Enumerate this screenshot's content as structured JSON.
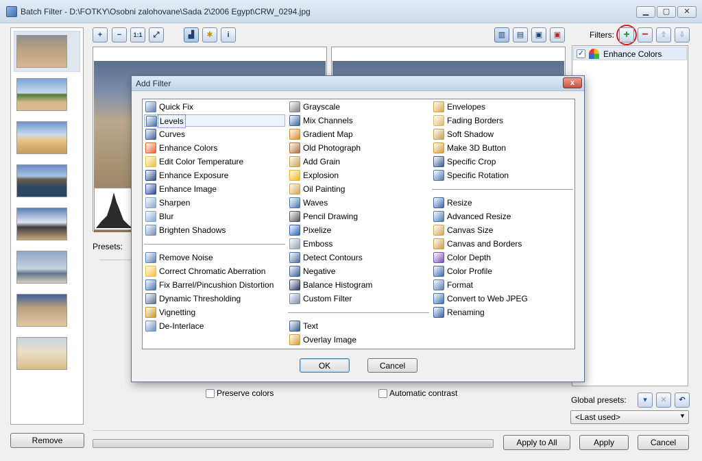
{
  "window": {
    "title": "Batch Filter - D:\\FOTKY\\Osobni zalohovane\\Sada 2\\2006 Egypt\\CRW_0294.jpg",
    "controls": [
      "minimize",
      "maximize",
      "close"
    ]
  },
  "toolbar": {
    "zoom_in": "+",
    "zoom_out": "−",
    "actual_size": "1:1",
    "fit": "⤢",
    "histogram": "▟",
    "auto": "✱",
    "info": "i"
  },
  "filters_panel": {
    "label": "Filters:",
    "items": [
      {
        "checked": true,
        "label": "Enhance Colors"
      }
    ]
  },
  "options": {
    "presets_label": "Presets:",
    "preserve_colors": "Preserve colors",
    "automatic_contrast": "Automatic contrast"
  },
  "global_presets": {
    "label": "Global presets:",
    "selected": "<Last used>"
  },
  "buttons": {
    "remove": "Remove",
    "apply_to_all": "Apply to All",
    "apply": "Apply",
    "cancel": "Cancel"
  },
  "dialog": {
    "title": "Add Filter",
    "close": "x",
    "ok": "OK",
    "cancel": "Cancel",
    "columns": [
      [
        {
          "label": "Quick Fix",
          "icon": "quick-fix-icon",
          "color": "#5b7fb3"
        },
        {
          "label": "Levels",
          "icon": "levels-icon",
          "color": "#4a6fa8",
          "selected": true
        },
        {
          "label": "Curves",
          "icon": "curves-icon",
          "color": "#3c5f98"
        },
        {
          "label": "Enhance Colors",
          "icon": "rainbow-icon",
          "color": "#e0662c"
        },
        {
          "label": "Edit Color Temperature",
          "icon": "bulb-icon",
          "color": "#e8c23a"
        },
        {
          "label": "Enhance Exposure",
          "icon": "exposure-icon",
          "color": "#2c4d86"
        },
        {
          "label": "Enhance Image",
          "icon": "enhance-image-icon",
          "color": "#27499a"
        },
        {
          "label": "Sharpen",
          "icon": "sharpen-icon",
          "color": "#8aa4c8"
        },
        {
          "label": "Blur",
          "icon": "blur-icon",
          "color": "#7fa8d6"
        },
        {
          "label": "Brighten Shadows",
          "icon": "shadows-icon",
          "color": "#6f8db8"
        },
        {
          "label": "Remove Noise",
          "icon": "noise-icon",
          "color": "#5e81b8"
        },
        {
          "label": "Correct Chromatic Aberration",
          "icon": "star-icon",
          "color": "#f0c23a"
        },
        {
          "label": "Fix Barrel/Pincushion Distortion",
          "icon": "distortion-icon",
          "color": "#4a76b0"
        },
        {
          "label": "Dynamic Thresholding",
          "icon": "threshold-icon",
          "color": "#5b6f8e"
        },
        {
          "label": "Vignetting",
          "icon": "vignette-icon",
          "color": "#c59a2e"
        },
        {
          "label": "De-Interlace",
          "icon": "deinterlace-icon",
          "color": "#6c8cbc"
        }
      ],
      [
        {
          "label": "Grayscale",
          "icon": "grayscale-icon",
          "color": "#808080"
        },
        {
          "label": "Mix Channels",
          "icon": "mix-channels-icon",
          "color": "#3d62a0"
        },
        {
          "label": "Gradient Map",
          "icon": "gradient-icon",
          "color": "#d98a2a"
        },
        {
          "label": "Old Photograph",
          "icon": "old-photo-icon",
          "color": "#a8743a"
        },
        {
          "label": "Add Grain",
          "icon": "grain-icon",
          "color": "#c9a24e"
        },
        {
          "label": "Explosion",
          "icon": "explosion-icon",
          "color": "#f2b21c"
        },
        {
          "label": "Oil Painting",
          "icon": "palette-icon",
          "color": "#d2a452"
        },
        {
          "label": "Waves",
          "icon": "waves-icon",
          "color": "#4a73b4"
        },
        {
          "label": "Pencil Drawing",
          "icon": "pencil-icon",
          "color": "#555555"
        },
        {
          "label": "Pixelize",
          "icon": "pixelize-icon",
          "color": "#2f63b6"
        },
        {
          "label": "Emboss",
          "icon": "emboss-icon",
          "color": "#8f9fb5"
        },
        {
          "label": "Detect Contours",
          "icon": "contours-icon",
          "color": "#4c6d9e"
        },
        {
          "label": "Negative",
          "icon": "negative-icon",
          "color": "#3b5e9a"
        },
        {
          "label": "Balance Histogram",
          "icon": "histogram-icon",
          "color": "#2e3f5f"
        },
        {
          "label": "Custom Filter",
          "icon": "grid-icon",
          "color": "#7a8ea8"
        },
        {
          "label": "Text",
          "icon": "text-icon",
          "color": "#3a5a8c"
        },
        {
          "label": "Overlay Image",
          "icon": "overlay-icon",
          "color": "#d59b2c"
        }
      ],
      [
        {
          "label": "Envelopes",
          "icon": "envelope-icon",
          "color": "#d8a542"
        },
        {
          "label": "Fading Borders",
          "icon": "fading-borders-icon",
          "color": "#e2b86a"
        },
        {
          "label": "Soft Shadow",
          "icon": "soft-shadow-icon",
          "color": "#c4a050"
        },
        {
          "label": "Make 3D Button",
          "icon": "button-3d-icon",
          "color": "#d69b36"
        },
        {
          "label": "Specific Crop",
          "icon": "crop-icon",
          "color": "#3a5c92"
        },
        {
          "label": "Specific Rotation",
          "icon": "rotate-icon",
          "color": "#4f79b4"
        },
        {
          "label": "Resize",
          "icon": "resize-icon",
          "color": "#3b67a8"
        },
        {
          "label": "Advanced Resize",
          "icon": "advanced-resize-icon",
          "color": "#4e78b4"
        },
        {
          "label": "Canvas Size",
          "icon": "canvas-size-icon",
          "color": "#d6a850"
        },
        {
          "label": "Canvas and Borders",
          "icon": "canvas-borders-icon",
          "color": "#cf9c46"
        },
        {
          "label": "Color Depth",
          "icon": "color-depth-icon",
          "color": "#7a4fb4"
        },
        {
          "label": "Color Profile",
          "icon": "color-profile-icon",
          "color": "#3f67a8"
        },
        {
          "label": "Format",
          "icon": "format-icon",
          "color": "#5a7ab0"
        },
        {
          "label": "Convert to Web JPEG",
          "icon": "web-jpeg-icon",
          "color": "#3d6db0"
        },
        {
          "label": "Renaming",
          "icon": "renaming-icon",
          "color": "#3a62a2"
        }
      ]
    ]
  }
}
